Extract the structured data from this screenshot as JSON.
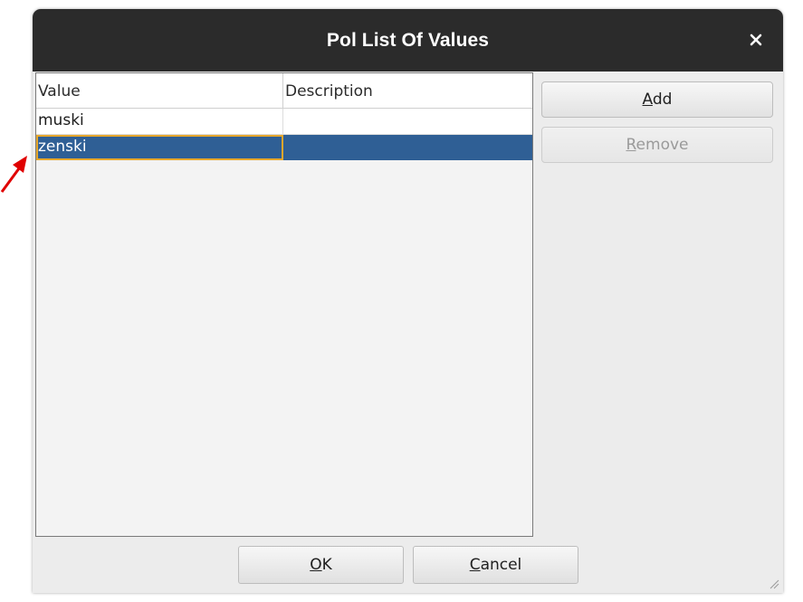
{
  "dialog": {
    "title": "Pol List Of Values",
    "close_icon": "close-icon"
  },
  "table": {
    "columns": [
      "Value",
      "Description"
    ],
    "rows": [
      {
        "value": "muski",
        "description": ""
      },
      {
        "value": "zenski",
        "description": "",
        "selected": true
      }
    ]
  },
  "buttons": {
    "add_mnemonic": "A",
    "add_rest": "dd",
    "remove_mnemonic": "R",
    "remove_rest": "emove",
    "ok_mnemonic": "O",
    "ok_rest": "K",
    "cancel_mnemonic": "C",
    "cancel_rest": "ancel"
  },
  "colors": {
    "titlebar": "#2b2b2b",
    "selection": "#2f5f95",
    "focus_border": "#e6a72c",
    "annotation_arrow": "#e00000"
  }
}
